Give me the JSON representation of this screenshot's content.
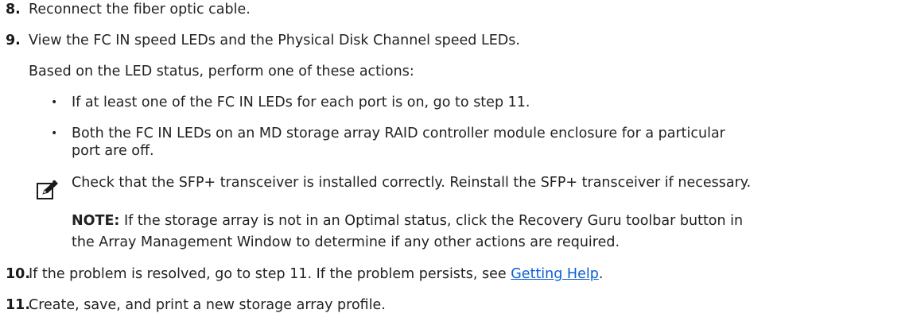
{
  "steps": [
    {
      "number": "8.",
      "text": "Reconnect the fiber optic cable."
    },
    {
      "number": "9.",
      "text": "View the FC IN speed LEDs and the Physical Disk Channel speed LEDs."
    },
    {
      "number": "10.",
      "text_before": "If the problem is resolved, go to step 11. If the problem persists, see ",
      "link": "Getting Help",
      "text_after": "."
    },
    {
      "number": "11.",
      "text": "Create, save, and print a new storage array profile."
    }
  ],
  "step9_intro": "Based on the LED status, perform one of these actions:",
  "bullets": [
    {
      "symbol": "•",
      "lines": [
        "If at least one of the FC IN LEDs for each port is on, go to step 11."
      ]
    },
    {
      "symbol": "•",
      "lines": [
        "Both the FC IN LEDs on an MD storage array RAID controller module enclosure for a particular",
        "port are off."
      ]
    },
    {
      "symbol": "•",
      "lines": [
        "Check that the SFP+ transceiver is installed correctly. Reinstall the SFP+ transceiver if necessary."
      ]
    }
  ],
  "note": {
    "icon": "note-pencil-icon",
    "label": "NOTE:",
    "line1": " If the storage array is not in an Optimal status, click the Recovery Guru toolbar button in",
    "line2": "the Array Management Window to determine if any other actions are required."
  }
}
